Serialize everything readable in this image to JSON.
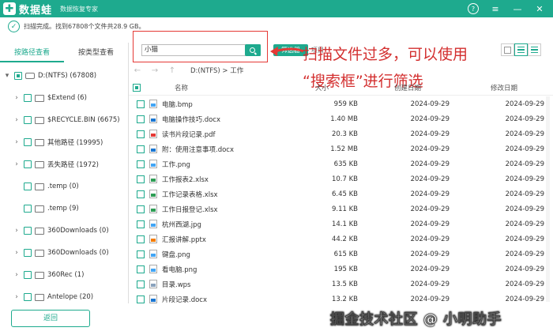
{
  "app": {
    "name": "数据蛙",
    "subtitle": "数据恢复专家",
    "brand_color": "#1eaa8e"
  },
  "window": {
    "help_icon": "?",
    "menu_icon": "≡",
    "minimize_icon": "—",
    "close_icon": "✕"
  },
  "status": {
    "message": "扫描完成。找到67808个文件共28.9 GB。"
  },
  "left_tabs": [
    {
      "label": "按路径查看",
      "active": true
    },
    {
      "label": "按类型查看",
      "active": false
    }
  ],
  "tree": [
    {
      "label": "D:(NTFS) (67808)"
    },
    {
      "label": "$Extend (6)"
    },
    {
      "label": "$RECYCLE.BIN (6675)"
    },
    {
      "label": "其他路径 (19995)"
    },
    {
      "label": "丢失路径 (1972)"
    },
    {
      "label": ".temp (0)"
    },
    {
      "label": ".temp (9)"
    },
    {
      "label": "360Downloads (0)"
    },
    {
      "label": "360Downloads (0)"
    },
    {
      "label": "360Rec (1)"
    },
    {
      "label": "Antelope (20)"
    }
  ],
  "search": {
    "value": "小猫"
  },
  "toolbar": {
    "filter_label": "筛选器",
    "filter_extra": "项目"
  },
  "annotation": {
    "line1": "扫描文件过多，可以使用",
    "line2": "“搜索框”进行筛选"
  },
  "nav": {
    "back_glyph": "←",
    "forward_glyph": "→",
    "up_glyph": "↑",
    "path": "D:(NTFS) > 工作"
  },
  "table": {
    "headers": {
      "name": "名称",
      "size": "大小",
      "created": "创建日期",
      "modified": "修改日期"
    },
    "rows": [
      {
        "name": "电脑.bmp",
        "type": "img",
        "size": "959 KB",
        "created": "2024-09-29",
        "modified": "2024-09-29"
      },
      {
        "name": "电脑操作技巧.docx",
        "type": "doc",
        "size": "1.40 MB",
        "created": "2024-09-29",
        "modified": "2024-09-29"
      },
      {
        "name": "读书片段记录.pdf",
        "type": "pdf",
        "size": "20.3 KB",
        "created": "2024-09-29",
        "modified": "2024-09-29"
      },
      {
        "name": "附：使用注意事项.docx",
        "type": "doc",
        "size": "1.52 MB",
        "created": "2024-09-29",
        "modified": "2024-09-29"
      },
      {
        "name": "工作.png",
        "type": "img",
        "size": "635 KB",
        "created": "2024-09-29",
        "modified": "2024-09-29"
      },
      {
        "name": "工作报表2.xlsx",
        "type": "xls",
        "size": "10.7 KB",
        "created": "2024-09-29",
        "modified": "2024-09-29"
      },
      {
        "name": "工作记录表格.xlsx",
        "type": "xls",
        "size": "6.45 KB",
        "created": "2024-09-29",
        "modified": "2024-09-29"
      },
      {
        "name": "工作日报登记.xlsx",
        "type": "xls",
        "size": "9.11 KB",
        "created": "2024-09-29",
        "modified": "2024-09-29"
      },
      {
        "name": "杭州西湖.jpg",
        "type": "img",
        "size": "14.1 KB",
        "created": "2024-09-29",
        "modified": "2024-09-29"
      },
      {
        "name": "汇报讲解.pptx",
        "type": "ppt",
        "size": "44.2 KB",
        "created": "2024-09-29",
        "modified": "2024-09-29"
      },
      {
        "name": "键盘.png",
        "type": "img",
        "size": "615 KB",
        "created": "2024-09-29",
        "modified": "2024-09-29"
      },
      {
        "name": "看电脑.png",
        "type": "img",
        "size": "195 KB",
        "created": "2024-09-29",
        "modified": "2024-09-29"
      },
      {
        "name": "目录.wps",
        "type": "wps",
        "size": "13.5 KB",
        "created": "2024-09-29",
        "modified": "2024-09-29"
      },
      {
        "name": "片段记录.docx",
        "type": "doc",
        "size": "13.2 KB",
        "created": "2024-09-29",
        "modified": "2024-09-29"
      }
    ]
  },
  "footer": {
    "back_label": "返回",
    "watermark": "掘金技术社区 @ 小明助手"
  }
}
